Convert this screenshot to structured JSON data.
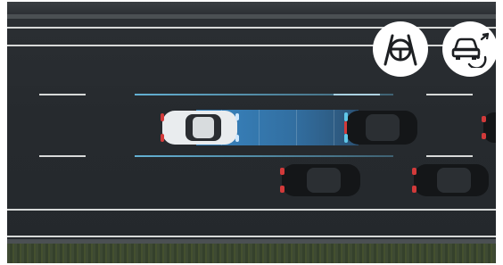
{
  "scene": {
    "road_color": "#272b2f",
    "radar_color": "#3c96dc",
    "lane_marker_color": "#6ec8f0"
  },
  "badges": [
    {
      "icon": "lane-keeping-steering-icon"
    },
    {
      "icon": "distance-control-icon"
    }
  ],
  "vehicles": [
    {
      "kind": "ego-car",
      "color": "white"
    },
    {
      "kind": "lead-car",
      "color": "black"
    },
    {
      "kind": "adjacent-car",
      "color": "black"
    },
    {
      "kind": "adjacent-car",
      "color": "black"
    },
    {
      "kind": "adjacent-car",
      "color": "black"
    }
  ]
}
